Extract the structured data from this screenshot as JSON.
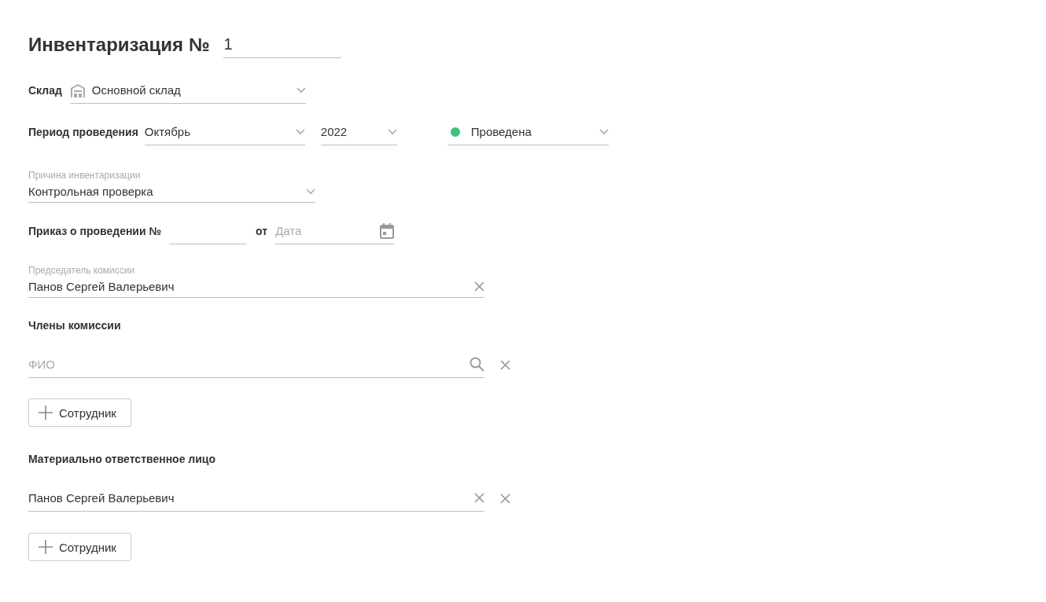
{
  "title": "Инвентаризация №",
  "number": "1",
  "warehouse": {
    "label": "Склад",
    "value": "Основной склад"
  },
  "period": {
    "label": "Период проведения",
    "month": "Октябрь",
    "year": "2022"
  },
  "status": {
    "value": "Проведена",
    "color": "#3ec27f"
  },
  "reason": {
    "label": "Причина инвентаризации",
    "value": "Контрольная проверка"
  },
  "order": {
    "label": "Приказ о проведении №",
    "date_label": "от",
    "date_placeholder": "Дата"
  },
  "chairman": {
    "label": "Председатель комиссии",
    "value": "Панов Сергей Валерьевич"
  },
  "members": {
    "label": "Члены комиссии",
    "entries": [
      {
        "placeholder": "ФИО"
      }
    ],
    "add_button": "Сотрудник"
  },
  "responsible": {
    "label": "Материально ответственное лицо",
    "entries": [
      {
        "value": "Панов Сергей Валерьевич"
      }
    ],
    "add_button": "Сотрудник"
  }
}
